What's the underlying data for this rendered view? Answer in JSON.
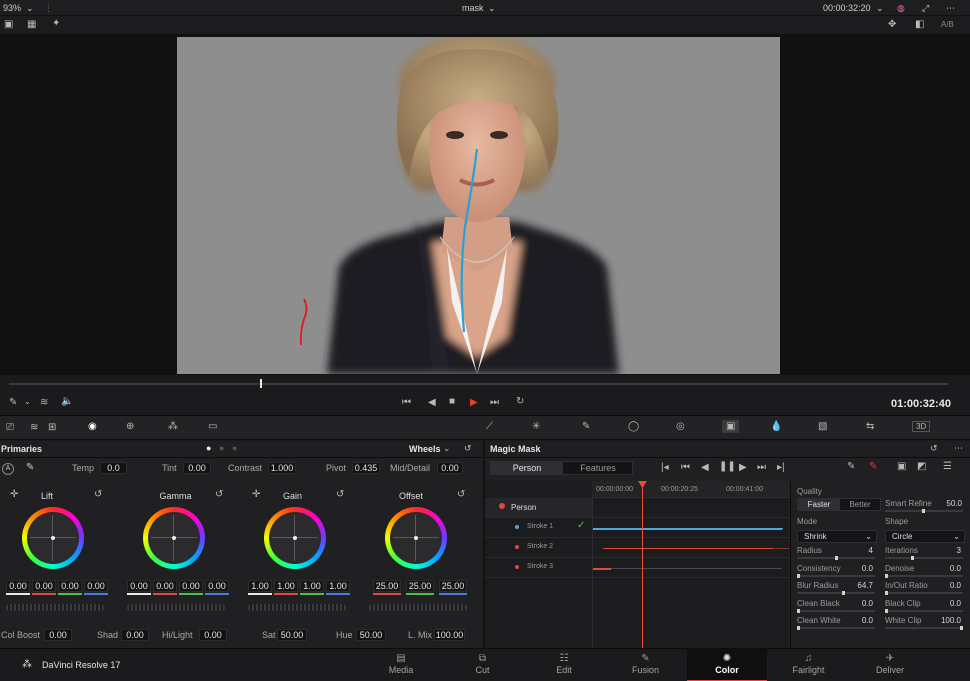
{
  "top": {
    "zoom": "93%",
    "clip_name": "mask",
    "timecode": "00:00:32:20",
    "ab_label": "A/B"
  },
  "transport": {
    "timecode": "01:00:32:40"
  },
  "primaries": {
    "title": "Primaries",
    "mode": "Wheels",
    "row1": {
      "temp_label": "Temp",
      "temp": "0.0",
      "tint_label": "Tint",
      "tint": "0.00",
      "contrast_label": "Contrast",
      "contrast": "1.000",
      "pivot_label": "Pivot",
      "pivot": "0.435",
      "middetail_label": "Mid/Detail",
      "middetail": "0.00"
    },
    "wheels": [
      {
        "name": "Lift",
        "values": [
          "0.00",
          "0.00",
          "0.00",
          "0.00"
        ]
      },
      {
        "name": "Gamma",
        "values": [
          "0.00",
          "0.00",
          "0.00",
          "0.00"
        ]
      },
      {
        "name": "Gain",
        "values": [
          "1.00",
          "1.00",
          "1.00",
          "1.00"
        ]
      },
      {
        "name": "Offset",
        "values": [
          "25.00",
          "25.00",
          "25.00"
        ]
      }
    ],
    "row2": {
      "colboost_label": "Col Boost",
      "colboost": "0.00",
      "shad_label": "Shad",
      "shad": "0.00",
      "hilight_label": "Hi/Light",
      "hilight": "0.00",
      "sat_label": "Sat",
      "sat": "50.00",
      "hue_label": "Hue",
      "hue": "50.00",
      "lmix_label": "L. Mix",
      "lmix": "100.00"
    }
  },
  "magic_mask": {
    "title": "Magic Mask",
    "tab_person": "Person",
    "tab_features": "Features",
    "ruler": [
      "00:00:00:00",
      "00:00:20:25",
      "00:00:41:00"
    ],
    "tracks": [
      {
        "label": "Person",
        "color": "#e04a3a"
      },
      {
        "label": "Stroke 1",
        "color": "#4aa8e0"
      },
      {
        "label": "Stroke 2",
        "color": "#e04a3a"
      },
      {
        "label": "Stroke 3",
        "color": "#e04a3a"
      }
    ],
    "quality_label": "Quality",
    "faster": "Faster",
    "better": "Better",
    "smart_refine_label": "Smart Refine",
    "smart_refine": "50.0",
    "mode_label": "Mode",
    "mode": "Shrink",
    "shape_label": "Shape",
    "shape": "Circle",
    "params": [
      {
        "label": "Radius",
        "value": "4",
        "col": 0
      },
      {
        "label": "Iterations",
        "value": "3",
        "col": 1
      },
      {
        "label": "Consistency",
        "value": "0.0",
        "col": 0
      },
      {
        "label": "Denoise",
        "value": "0.0",
        "col": 1
      },
      {
        "label": "Blur Radius",
        "value": "64.7",
        "col": 0
      },
      {
        "label": "In/Out Ratio",
        "value": "0.0",
        "col": 1
      },
      {
        "label": "Clean Black",
        "value": "0.0",
        "col": 0
      },
      {
        "label": "Black Clip",
        "value": "0.0",
        "col": 1
      },
      {
        "label": "Clean White",
        "value": "0.0",
        "col": 0
      },
      {
        "label": "White Clip",
        "value": "100.0",
        "col": 1
      }
    ]
  },
  "footer": {
    "app": "DaVinci Resolve 17",
    "pages": [
      "Media",
      "Cut",
      "Edit",
      "Fusion",
      "Color",
      "Fairlight",
      "Deliver"
    ],
    "active": "Color"
  }
}
